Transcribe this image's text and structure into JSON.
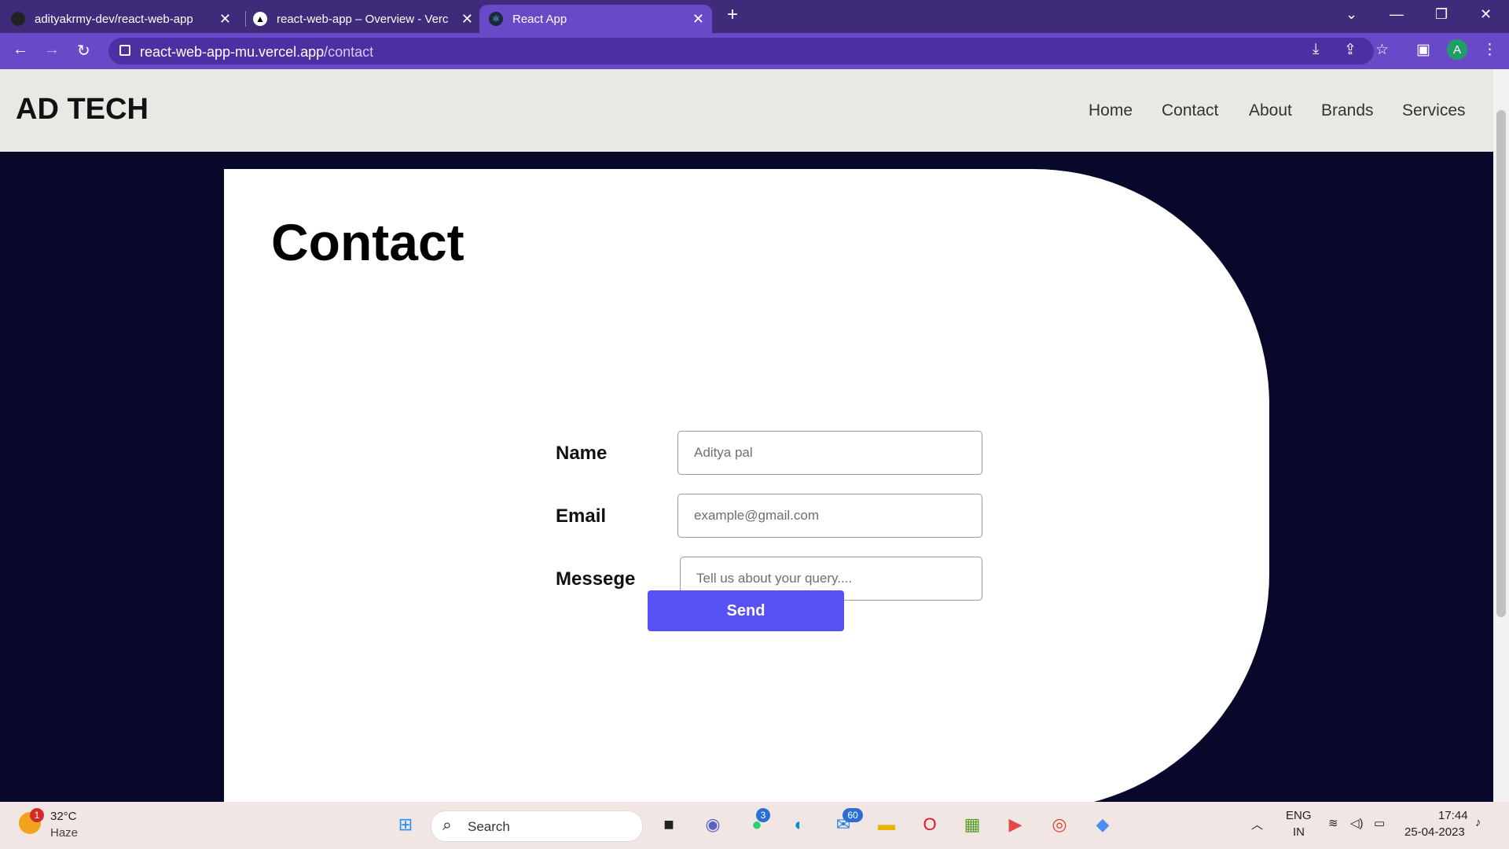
{
  "browser": {
    "tabs": [
      {
        "title": "adityakrmy-dev/react-web-app",
        "active": false
      },
      {
        "title": "react-web-app – Overview - Verc",
        "active": false
      },
      {
        "title": "React App",
        "active": true
      }
    ],
    "new_tab_label": "+",
    "url_host": "react-web-app-mu.vercel.app",
    "url_path": "/contact",
    "profile_initial": "A",
    "accent_color": "#6a49c8"
  },
  "site": {
    "logo": "AD TECH",
    "nav": [
      "Home",
      "Contact",
      "About",
      "Brands",
      "Services"
    ]
  },
  "contact": {
    "heading": "Contact",
    "name_label": "Name",
    "name_placeholder": "Aditya pal",
    "email_label": "Email",
    "email_placeholder": "example@gmail.com",
    "message_label": "Messege",
    "message_placeholder": "Tell us about your query....",
    "send_label": "Send",
    "button_color": "#5650f5"
  },
  "taskbar": {
    "weather_badge": "1",
    "temperature": "32°C",
    "weather": "Haze",
    "search_label": "Search",
    "whatsapp_badge": "3",
    "mail_badge": "60",
    "lang_line1": "ENG",
    "lang_line2": "IN",
    "time": "17:44",
    "date": "25-04-2023"
  }
}
